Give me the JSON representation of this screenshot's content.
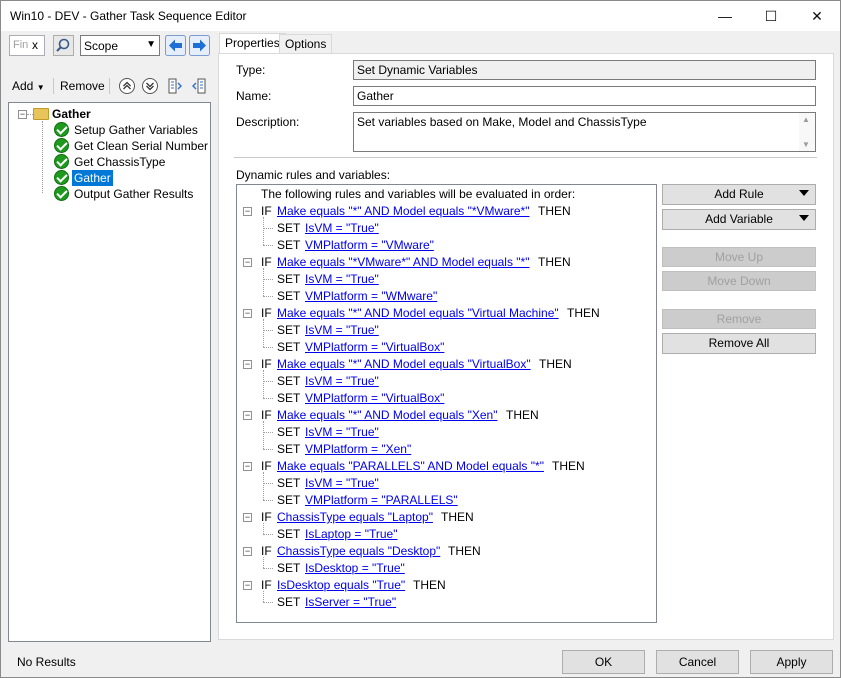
{
  "window": {
    "title": "Win10 - DEV - Gather Task Sequence Editor",
    "controls": {
      "minimize": "—",
      "maximize": "☐",
      "close": "✕"
    }
  },
  "left_toolbar": {
    "find_placeholder": "Fin",
    "find_clear": "x",
    "scope_value": "Scope",
    "add_label": "Add",
    "remove_label": "Remove"
  },
  "tree": {
    "root": "Gather",
    "items": [
      {
        "label": "Setup Gather Variables"
      },
      {
        "label": "Get Clean Serial Number"
      },
      {
        "label": "Get ChassisType"
      },
      {
        "label": "Gather"
      },
      {
        "label": "Output Gather Results"
      }
    ],
    "selected_index": 3
  },
  "tabs": [
    "Properties",
    "Options"
  ],
  "properties": {
    "type_label": "Type:",
    "type_value": "Set Dynamic Variables",
    "name_label": "Name:",
    "name_value": "Gather",
    "description_label": "Description:",
    "description_value": "Set variables based on Make, Model and ChassisType",
    "dynamic_label": "Dynamic rules and variables:",
    "rules_intro": "The following rules and variables will be evaluated in order:"
  },
  "rules": [
    {
      "cond": "Make equals \"*\" AND Model equals \"*VMware*\"",
      "sets": [
        "IsVM = \"True\"",
        "VMPlatform = \"VMware\""
      ]
    },
    {
      "cond": "Make equals \"*VMware*\" AND Model equals \"*\"",
      "sets": [
        "IsVM = \"True\"",
        "VMPlatform = \"WMware\""
      ]
    },
    {
      "cond": "Make equals \"*\" AND Model equals \"Virtual Machine\"",
      "sets": [
        "IsVM = \"True\"",
        "VMPlatform = \"VirtualBox\""
      ]
    },
    {
      "cond": "Make equals \"*\" AND Model equals \"VirtualBox\"",
      "sets": [
        "IsVM = \"True\"",
        "VMPlatform = \"VirtualBox\""
      ]
    },
    {
      "cond": "Make equals \"*\" AND Model equals \"Xen\"",
      "sets": [
        "IsVM = \"True\"",
        "VMPlatform = \"Xen\""
      ]
    },
    {
      "cond": "Make equals \"PARALLELS\" AND Model equals \"*\"",
      "sets": [
        "IsVM = \"True\"",
        "VMPlatform = \"PARALLELS\""
      ]
    },
    {
      "cond": "ChassisType equals \"Laptop\"",
      "sets": [
        "IsLaptop = \"True\""
      ]
    },
    {
      "cond": "ChassisType equals \"Desktop\"",
      "sets": [
        "IsDesktop = \"True\""
      ]
    },
    {
      "cond": "IsDesktop equals \"True\"",
      "sets": [
        "IsServer = \"True\""
      ]
    }
  ],
  "keywords": {
    "if": "IF",
    "then": "THEN",
    "set": "SET"
  },
  "side_buttons": {
    "add_rule": "Add Rule",
    "add_variable": "Add Variable",
    "move_up": "Move Up",
    "move_down": "Move Down",
    "remove": "Remove",
    "remove_all": "Remove All"
  },
  "footer": {
    "status": "No Results",
    "ok": "OK",
    "cancel": "Cancel",
    "apply": "Apply"
  },
  "colors": {
    "link": "#0000ee",
    "selection": "#0078d7",
    "check": "#1e9b1e",
    "arrow_blue": "#1f6fd6"
  }
}
